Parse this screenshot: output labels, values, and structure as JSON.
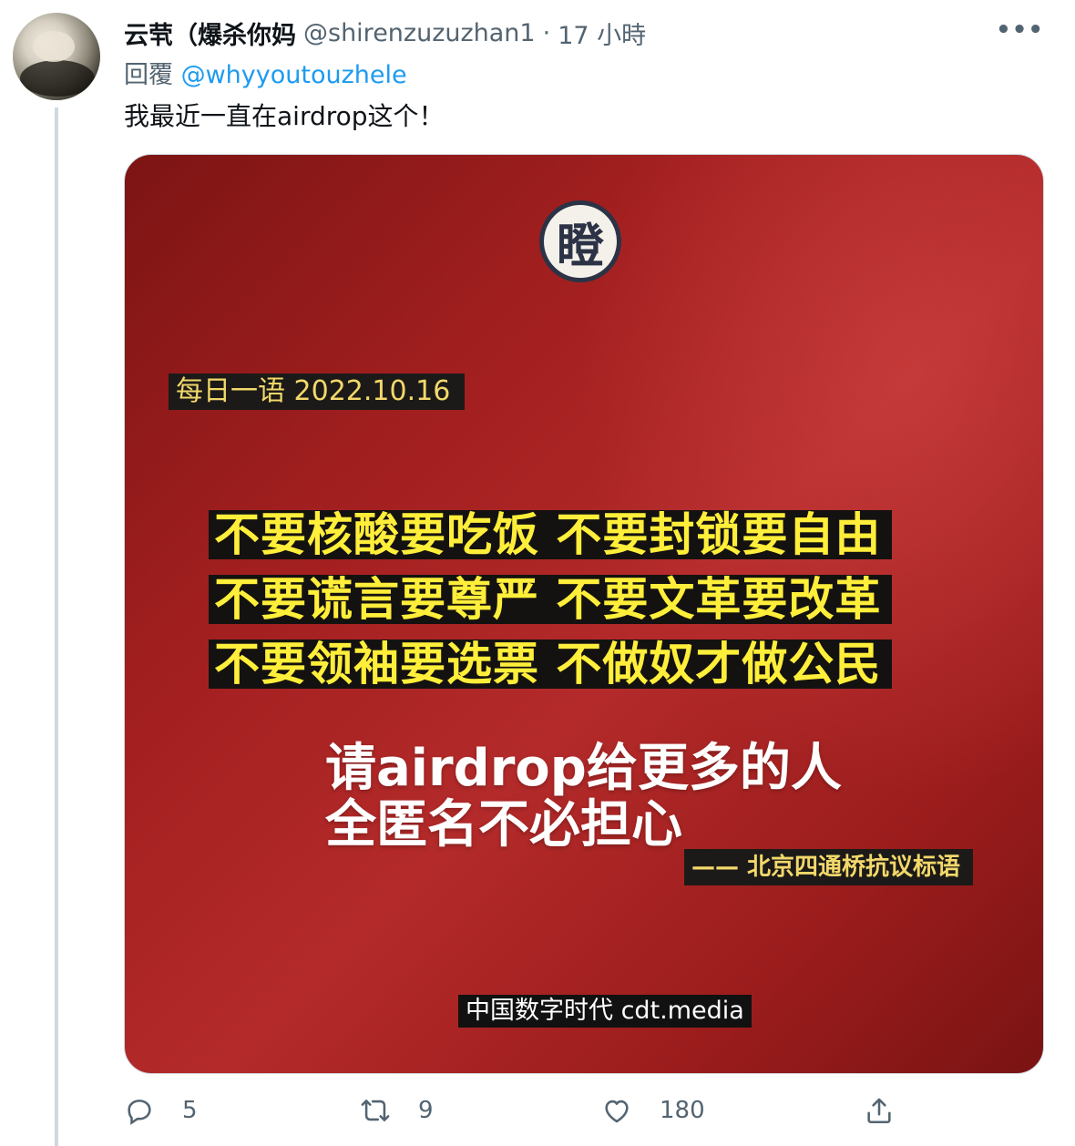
{
  "tweet": {
    "author_name": "云茕（爆杀你妈",
    "handle": "@shirenzuzuzhan1",
    "separator": "·",
    "time": "17 小時",
    "more": "•••",
    "reply_prefix": "回覆",
    "reply_to": "@whyyoutouzhele",
    "text": "我最近一直在airdrop这个！"
  },
  "image": {
    "logo_char": "瞪",
    "date_banner": "每日一语 2022.10.16",
    "slogans": [
      "不要核酸要吃饭 不要封锁要自由",
      "不要谎言要尊严 不要文革要改革",
      "不要领袖要选票 不做奴才做公民"
    ],
    "message_line1": "请airdrop给更多的人",
    "message_line2": "全匿名不必担心",
    "source": "—— 北京四通桥抗议标语",
    "watermark": "中国数字时代 cdt.media"
  },
  "actions": {
    "replies": "5",
    "retweets": "9",
    "likes": "180"
  },
  "colors": {
    "link": "#1d9bf0",
    "muted": "#536471",
    "slogan_text": "#ffee3a",
    "card_red": "#a21f1f"
  },
  "icons": [
    "reply-icon",
    "retweet-icon",
    "like-icon",
    "share-icon",
    "more-icon"
  ]
}
